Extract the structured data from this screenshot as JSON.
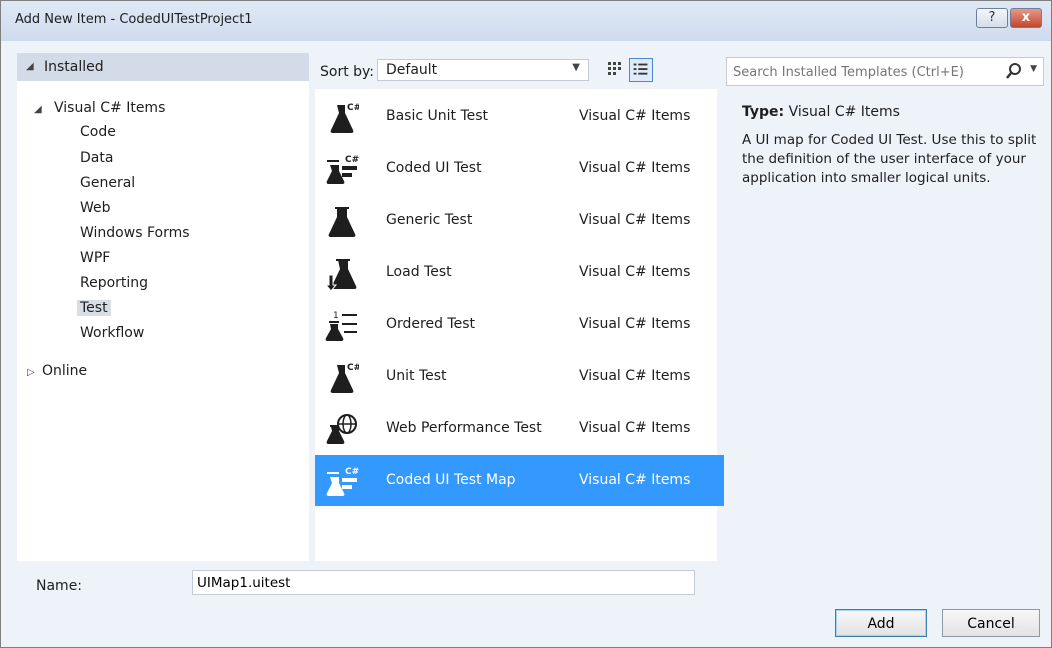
{
  "window": {
    "title": "Add New Item - CodedUITestProject1",
    "help_label": "?",
    "close_label": "x"
  },
  "left_panel": {
    "installed_label": "Installed",
    "tree": [
      {
        "label": "Visual C# Items",
        "children": [
          "Code",
          "Data",
          "General",
          "Web",
          "Windows Forms",
          "WPF",
          "Reporting",
          "Test",
          "Workflow"
        ],
        "selected": "Test"
      },
      {
        "label": "Online"
      }
    ]
  },
  "toolbar": {
    "sort_label": "Sort by:",
    "sort_value": "Default"
  },
  "templates": [
    {
      "name": "Basic Unit Test",
      "category": "Visual C# Items",
      "icon": "flask-csharp-icon"
    },
    {
      "name": "Coded UI Test",
      "category": "Visual C# Items",
      "icon": "coded-ui-test-icon"
    },
    {
      "name": "Generic Test",
      "category": "Visual C# Items",
      "icon": "flask-icon"
    },
    {
      "name": "Load Test",
      "category": "Visual C# Items",
      "icon": "load-test-icon"
    },
    {
      "name": "Ordered Test",
      "category": "Visual C# Items",
      "icon": "ordered-test-icon"
    },
    {
      "name": "Unit Test",
      "category": "Visual C# Items",
      "icon": "flask-csharp-icon"
    },
    {
      "name": "Web Performance Test",
      "category": "Visual C# Items",
      "icon": "web-performance-icon"
    },
    {
      "name": "Coded UI Test Map",
      "category": "Visual C# Items",
      "icon": "coded-ui-test-map-icon",
      "selected": true
    }
  ],
  "search": {
    "placeholder": "Search Installed Templates (Ctrl+E)"
  },
  "details": {
    "type_label": "Type:",
    "type_value": "Visual C# Items",
    "description": "A UI map for Coded UI Test. Use this to split the definition of the user interface of your application into smaller logical units."
  },
  "footer": {
    "name_label": "Name:",
    "name_value": "UIMap1.uitest",
    "add_label": "Add",
    "cancel_label": "Cancel"
  },
  "colors": {
    "selection": "#3399ff",
    "panel_bg": "#eef2f9",
    "header_bg": "#d4dbe8"
  }
}
